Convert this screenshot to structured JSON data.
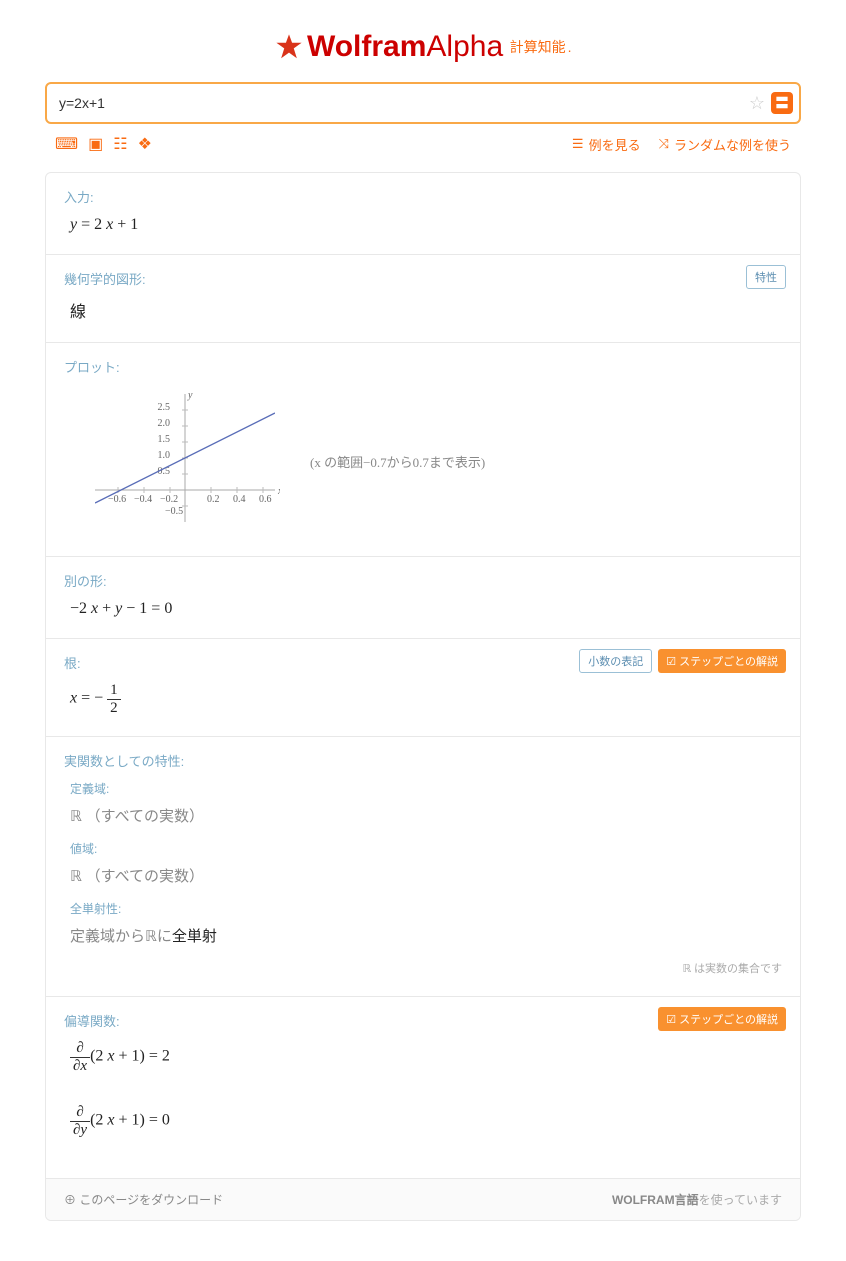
{
  "logo": {
    "brand_bold": "Wolfram",
    "brand_reg": "Alpha",
    "sub": "計算知能"
  },
  "search": {
    "value": "y=2x+1"
  },
  "toolbar": {
    "examples": "例を見る",
    "random": "ランダムな例を使う"
  },
  "pods": {
    "input": {
      "title": "入力:",
      "expr": "y = 2 x + 1"
    },
    "geom": {
      "title": "幾何学的図形:",
      "value": "線",
      "prop_btn": "特性"
    },
    "plot": {
      "title": "プロット:",
      "note": "(x の範囲−0.7から0.7まで表示)"
    },
    "altform": {
      "title": "別の形:",
      "expr": "−2 x + y − 1 = 0"
    },
    "root": {
      "title": "根:",
      "decimal_btn": "小数の表記",
      "step_btn": "ステップごとの解説",
      "x_eq": "x = −",
      "num": "1",
      "den": "2"
    },
    "realprops": {
      "title": "実関数としての特性:",
      "domain_t": "定義域:",
      "domain_v_sym": "ℝ",
      "domain_v_txt": "（すべての実数）",
      "range_t": "値域:",
      "range_v_sym": "ℝ",
      "range_v_txt": "（すべての実数）",
      "bij_t": "全単射性:",
      "bij_pre": "定義域から",
      "bij_r": "ℝ",
      "bij_mid": "に",
      "bij_bold": "全単射",
      "note": "ℝ は実数の集合です"
    },
    "partial": {
      "title": "偏導関数:",
      "step_btn": "ステップごとの解説",
      "dx_num": "∂",
      "dx_den": "∂x",
      "dx_body": "(2 x + 1) = 2",
      "dy_num": "∂",
      "dy_den": "∂y",
      "dy_body": "(2 x + 1) = 0"
    }
  },
  "footer": {
    "download": "このページをダウンロード",
    "lang_pre": "WOLFRAM言語",
    "lang_post": "を使っています"
  },
  "chart_data": {
    "type": "line",
    "title": "",
    "xlabel": "x",
    "ylabel": "y",
    "xlim": [
      -0.7,
      0.7
    ],
    "ylim": [
      -0.5,
      2.5
    ],
    "x_ticks": [
      -0.6,
      -0.4,
      -0.2,
      0.2,
      0.4,
      0.6
    ],
    "y_ticks": [
      -0.5,
      0.5,
      1.0,
      1.5,
      2.0,
      2.5
    ],
    "series": [
      {
        "name": "y=2x+1",
        "x": [
          -0.7,
          -0.6,
          -0.4,
          -0.2,
          0,
          0.2,
          0.4,
          0.6,
          0.7
        ],
        "values": [
          -0.4,
          -0.2,
          0.2,
          0.6,
          1.0,
          1.4,
          1.8,
          2.2,
          2.4
        ]
      }
    ]
  }
}
